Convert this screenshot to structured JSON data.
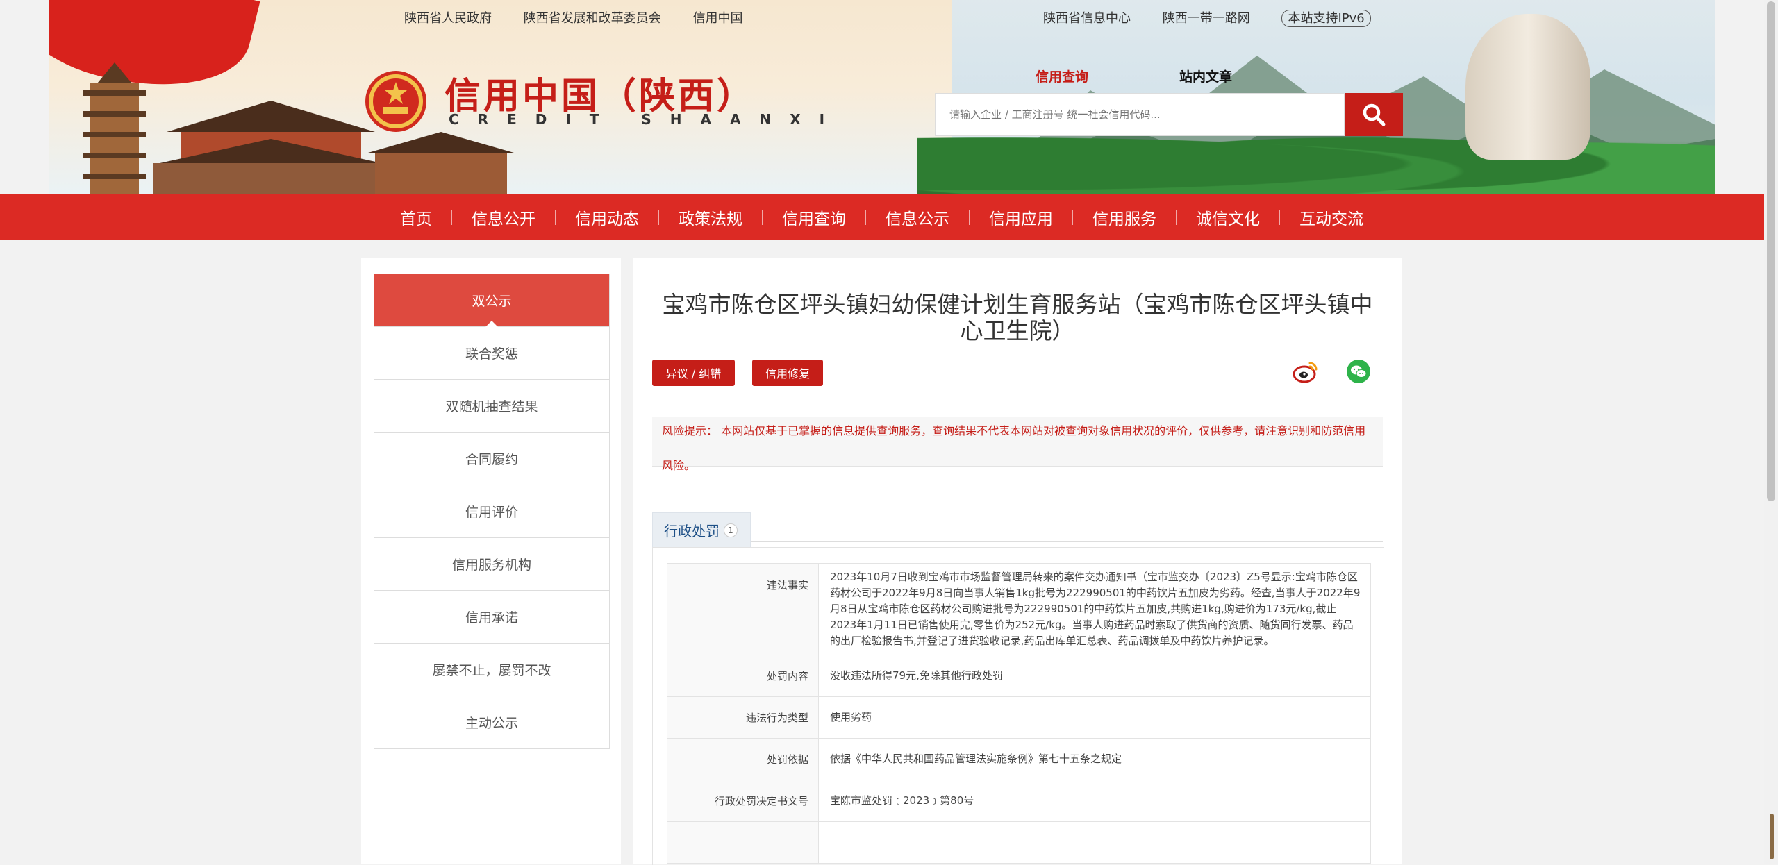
{
  "header": {
    "top_links_left": [
      "陕西省人民政府",
      "陕西省发展和改革委员会",
      "信用中国"
    ],
    "top_links_right": [
      "陕西省信息中心",
      "陕西一带一路网"
    ],
    "ipv6_badge": "本站支持IPv6",
    "brand_cn": "信用中国（陕西）",
    "brand_en": "CREDIT SHAANXI",
    "search_tabs": [
      "信用查询",
      "站内文章"
    ],
    "search_placeholder": "请输入企业 / 工商注册号 统一社会信用代码...",
    "colors": {
      "brand_red": "#c51e18",
      "nav_red": "#dc2a24"
    }
  },
  "nav": {
    "items": [
      "首页",
      "信息公开",
      "信用动态",
      "政策法规",
      "信用查询",
      "信息公示",
      "信用应用",
      "信用服务",
      "诚信文化",
      "互动交流"
    ]
  },
  "sidebar": {
    "items": [
      "双公示",
      "联合奖惩",
      "双随机抽查结果",
      "合同履约",
      "信用评价",
      "信用服务机构",
      "信用承诺",
      "屡禁不止，屡罚不改",
      "主动公示"
    ],
    "active_index": 0
  },
  "main": {
    "title": "宝鸡市陈仓区坪头镇妇幼保健计划生育服务站（宝鸡市陈仓区坪头镇中心卫生院）",
    "buttons": {
      "objection": "异议 / 纠错",
      "repair": "信用修复"
    },
    "share_icons": [
      "weibo-icon",
      "wechat-icon"
    ],
    "notice": "风险提示：  本网站仅基于已掌握的信息提供查询服务，查询结果不代表本网站对被查询对象信用状况的评价，仅供参考，请注意识别和防范信用风险。",
    "tab": {
      "label": "行政处罚",
      "count": "1"
    },
    "rows": [
      {
        "key": "违法事实",
        "value": "2023年10月7日收到宝鸡市市场监督管理局转来的案件交办通知书（宝市监交办〔2023〕Z5号显示:宝鸡市陈仓区药材公司于2022年9月8日向当事人销售1kg批号为222990501的中药饮片五加皮为劣药。经查,当事人于2022年9月8日从宝鸡市陈仓区药材公司购进批号为222990501的中药饮片五加皮,共购进1kg,购进价为173元/kg,截止2023年1月11日已销售使用完,零售价为252元/kg。当事人购进药品时索取了供货商的资质、随货同行发票、药品的出厂检验报告书,并登记了进货验收记录,药品出库单汇总表、药品调拨单及中药饮片养护记录。"
      },
      {
        "key": "处罚内容",
        "value": "没收违法所得79元,免除其他行政处罚"
      },
      {
        "key": "违法行为类型",
        "value": "使用劣药"
      },
      {
        "key": "处罚依据",
        "value": "依据《中华人民共和国药品管理法实施条例》第七十五条之规定"
      },
      {
        "key": "行政处罚决定书文号",
        "value": "宝陈市监处罚﹝2023﹞第80号"
      },
      {
        "key": "",
        "value": ""
      }
    ]
  }
}
